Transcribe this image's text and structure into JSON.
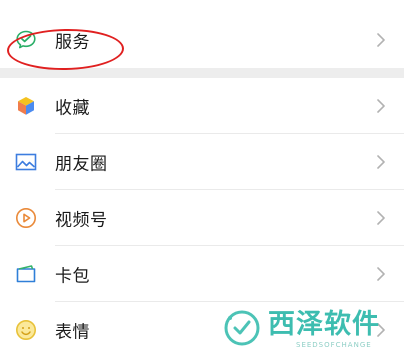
{
  "menu": {
    "service": {
      "label": "服务",
      "icon": "wechat-pay-icon"
    },
    "items": [
      {
        "label": "收藏",
        "icon": "favorites-cube-icon"
      },
      {
        "label": "朋友圈",
        "icon": "moments-image-icon"
      },
      {
        "label": "视频号",
        "icon": "channels-play-icon"
      },
      {
        "label": "卡包",
        "icon": "card-wallet-icon"
      },
      {
        "label": "表情",
        "icon": "sticker-smile-icon"
      }
    ]
  },
  "watermark": {
    "title": "西泽软件",
    "subtitle": "SEEDSOFCHANGE"
  },
  "colors": {
    "background": "#ededed",
    "highlight_ellipse": "#e02020",
    "watermark": "#3dbdb0"
  }
}
